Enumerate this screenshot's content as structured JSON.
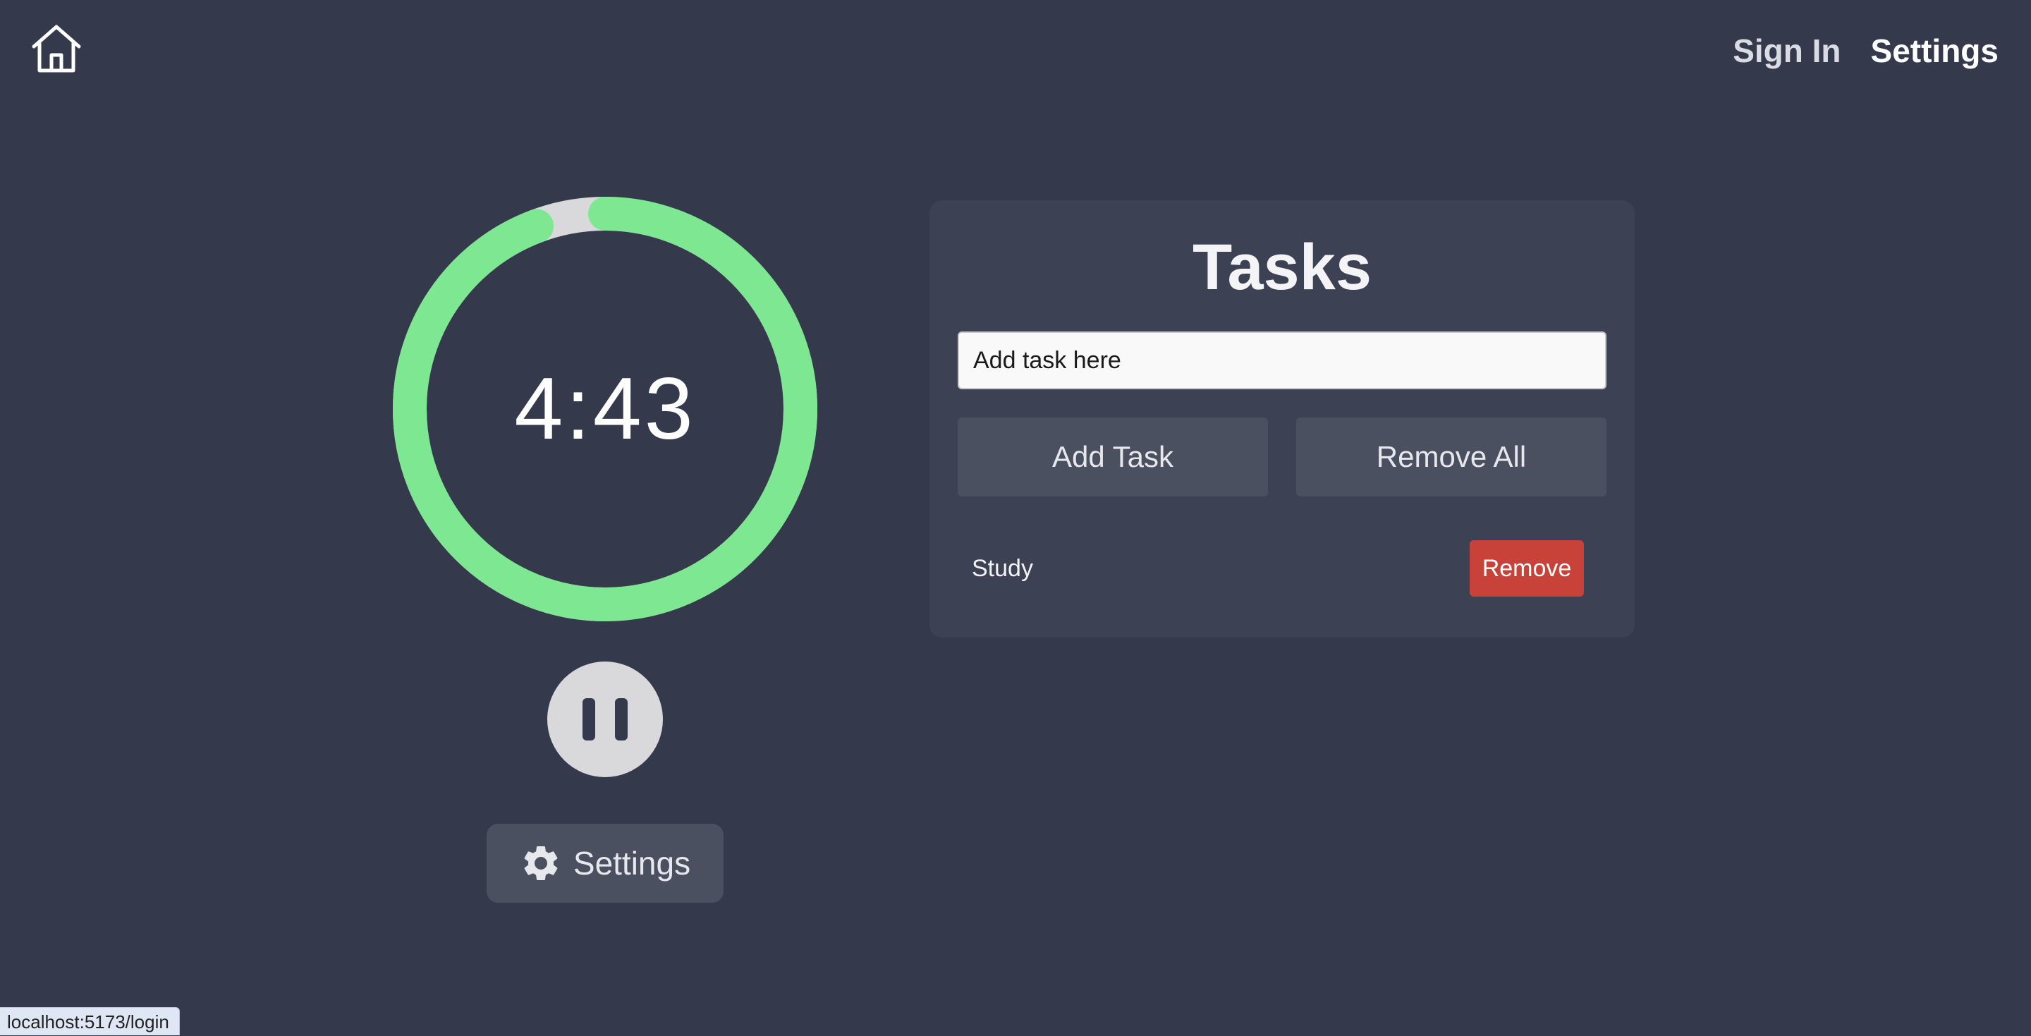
{
  "nav": {
    "home_icon": "home-icon",
    "sign_in": "Sign In",
    "settings": "Settings"
  },
  "timer": {
    "display": "4:43",
    "progress_fraction": 0.943,
    "progress_color": "#7de891",
    "track_color": "#d9d9dc"
  },
  "controls": {
    "pause_icon": "pause-icon",
    "settings_icon": "gear-icon",
    "settings_label": "Settings"
  },
  "tasks": {
    "title": "Tasks",
    "input_placeholder": "Add task here",
    "add_label": "Add Task",
    "remove_all_label": "Remove All",
    "items": [
      {
        "name": "Study",
        "remove_label": "Remove"
      }
    ]
  },
  "status_bar": {
    "url": "localhost:5173/login"
  },
  "colors": {
    "background": "#343a4b",
    "panel": "#3c4253",
    "button": "#4a5060",
    "remove": "#c9423a"
  }
}
